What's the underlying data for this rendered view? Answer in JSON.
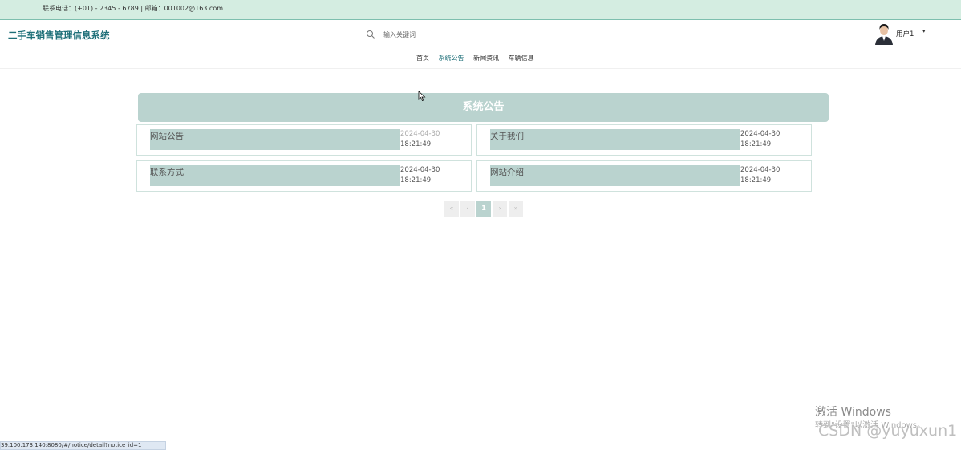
{
  "topbar": {
    "contact": "联系电话：(+01) - 2345 - 6789 | 邮箱：001002@163.com"
  },
  "header": {
    "logo": "二手车销售管理信息系统",
    "search_placeholder": "输入关键词",
    "nav": [
      "首页",
      "系统公告",
      "新闻资讯",
      "车辆信息"
    ],
    "user_name": "用户1",
    "user_caret": "▾"
  },
  "panel": {
    "title": "系统公告"
  },
  "notices": [
    {
      "title": "网站公告",
      "date": "2024-04-30",
      "time": "18:21:49"
    },
    {
      "title": "关于我们",
      "date": "2024-04-30",
      "time": "18:21:49"
    },
    {
      "title": "联系方式",
      "date": "2024-04-30",
      "time": "18:21:49"
    },
    {
      "title": "网站介绍",
      "date": "2024-04-30",
      "time": "18:21:49"
    }
  ],
  "pager": {
    "first": "«",
    "prev": "‹",
    "current": "1",
    "next": "›",
    "last": "»"
  },
  "watermarks": {
    "activate": "激活 Windows",
    "activate_sub": "转到\"设置\"以激活 Windows。",
    "csdn": "CSDN @yuyuxun1"
  },
  "status_url": "39.100.173.140:8080/#/notice/detail?notice_id=1",
  "colors": {
    "accent": "#1e6f78",
    "panel": "#bad3cf",
    "topbar": "#d4ede1"
  }
}
